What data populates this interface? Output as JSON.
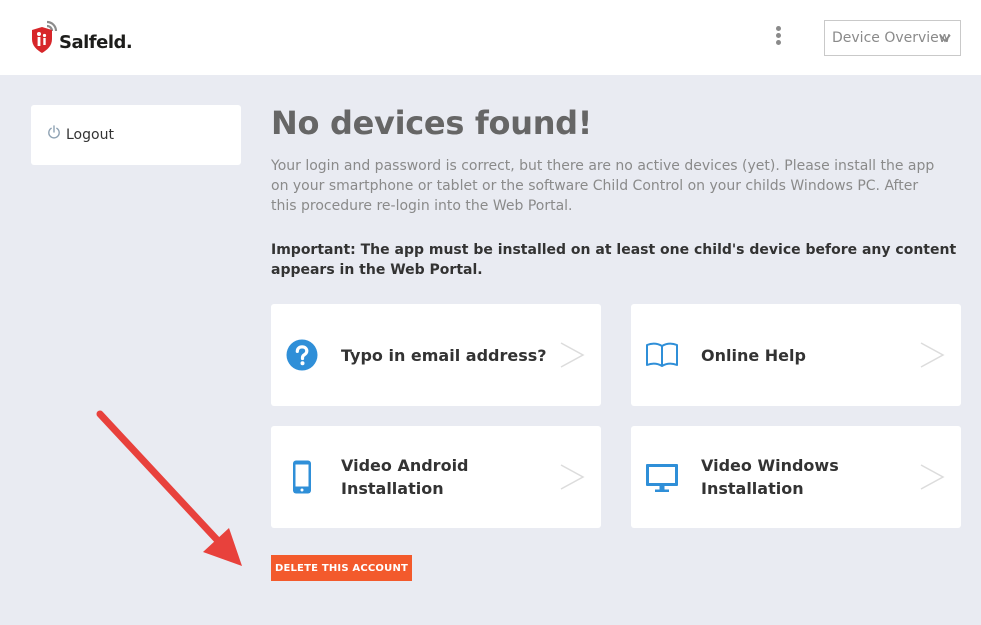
{
  "header": {
    "logo_text": "Salfeld.",
    "device_select": {
      "value": "Device Overview"
    }
  },
  "sidebar": {
    "logout_label": "Logout"
  },
  "main": {
    "title": "No devices found!",
    "description": "Your login and password is correct, but there are no active devices (yet). Please install the app on your smartphone or tablet or the software Child Control on your childs Windows PC. After this procedure re-login into the Web Portal.",
    "important": "Important: The app must be installed on at least one child's device before any content appears in the Web Portal.",
    "tiles": [
      {
        "label": "Typo in email address?",
        "icon": "question-icon"
      },
      {
        "label": "Online Help",
        "icon": "book-icon"
      },
      {
        "label": "Video Android Installation",
        "icon": "smartphone-icon"
      },
      {
        "label": "Video Windows Installation",
        "icon": "monitor-icon"
      }
    ],
    "delete_label": "DELETE THIS ACCOUNT"
  },
  "colors": {
    "accent_blue": "#2f8fd8",
    "delete_orange": "#f35a2c",
    "annotation_red": "#e8413c",
    "logo_red": "#d7262a"
  }
}
